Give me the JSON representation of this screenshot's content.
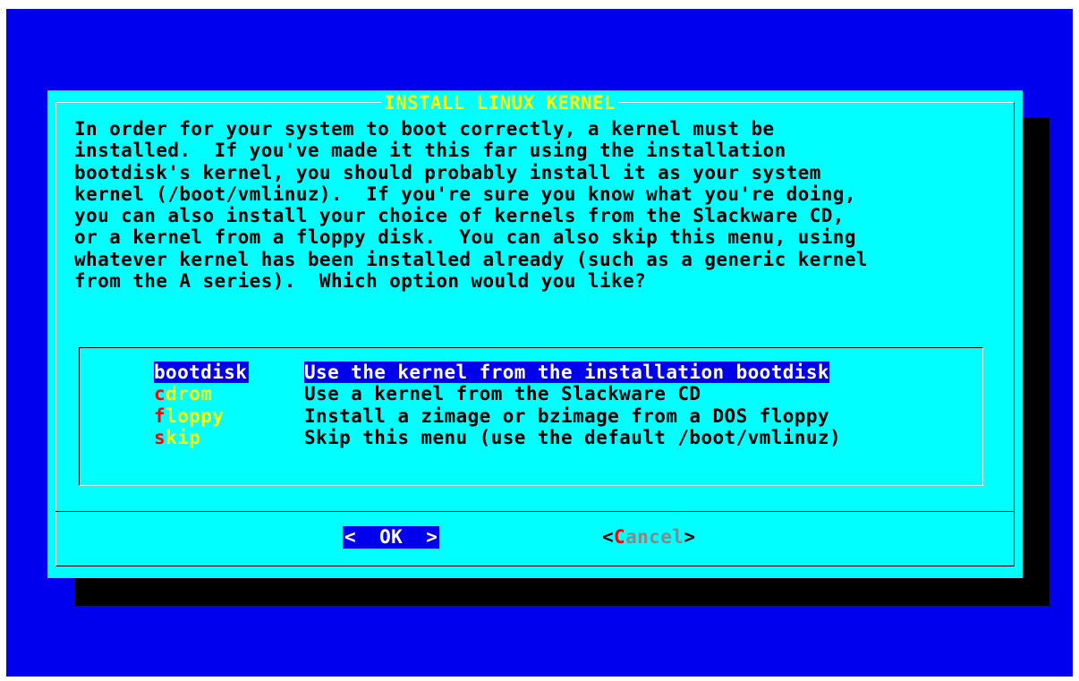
{
  "dialog": {
    "title": "INSTALL LINUX KERNEL",
    "body_lines": [
      "In order for your system to boot correctly, a kernel must be",
      "installed.  If you've made it this far using the installation",
      "bootdisk's kernel, you should probably install it as your system",
      "kernel (/boot/vmlinuz).  If you're sure you know what you're doing,",
      "you can also install your choice of kernels from the Slackware CD,",
      "or a kernel from a floppy disk.  You can also skip this menu, using",
      "whatever kernel has been installed already (such as a generic kernel",
      "from the A series).  Which option would you like?"
    ]
  },
  "menu": {
    "items": [
      {
        "hotkey": "b",
        "rest": "ootdisk",
        "description": "Use the kernel from the installation bootdisk"
      },
      {
        "hotkey": "c",
        "rest": "drom",
        "description": "Use a kernel from the Slackware CD"
      },
      {
        "hotkey": "f",
        "rest": "loppy",
        "description": "Install a zimage or bzimage from a DOS floppy"
      },
      {
        "hotkey": "s",
        "rest": "kip",
        "description": "Skip this menu (use the default /boot/vmlinuz)"
      }
    ],
    "selected_index": 0
  },
  "buttons": {
    "ok_label": "<  OK  >",
    "cancel_open": "<",
    "cancel_hotkey": "C",
    "cancel_rest": "ancel",
    "cancel_close": ">"
  },
  "colors": {
    "screen_background": "#0000ee",
    "dialog_background": "#00ffff",
    "title": "#ffff00",
    "hotkey": "#ff0000",
    "tag": "#ffff00",
    "selection": "#0000ee",
    "shadow": "#000000"
  }
}
